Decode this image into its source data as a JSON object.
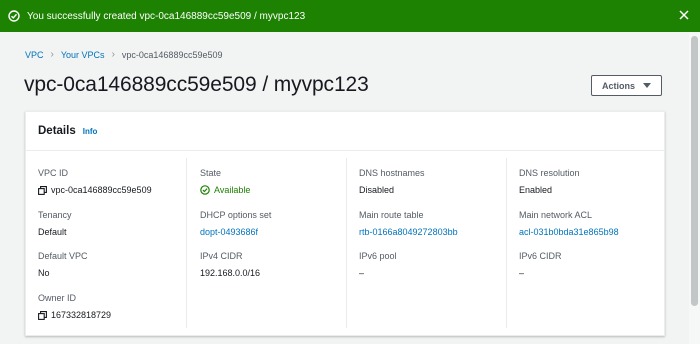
{
  "flash": {
    "message": "You successfully created vpc-0ca146889cc59e509 / myvpc123"
  },
  "breadcrumbs": [
    "VPC",
    "Your VPCs",
    "vpc-0ca146889cc59e509"
  ],
  "title": "vpc-0ca146889cc59e509 / myvpc123",
  "actions_label": "Actions",
  "details": {
    "heading": "Details",
    "info": "Info",
    "fields": {
      "vpc_id": {
        "label": "VPC ID",
        "value": "vpc-0ca146889cc59e509"
      },
      "tenancy": {
        "label": "Tenancy",
        "value": "Default"
      },
      "default_vpc": {
        "label": "Default VPC",
        "value": "No"
      },
      "owner_id": {
        "label": "Owner ID",
        "value": "167332818729"
      },
      "state": {
        "label": "State",
        "value": "Available"
      },
      "dhcp": {
        "label": "DHCP options set",
        "value": "dopt-0493686f"
      },
      "ipv4": {
        "label": "IPv4 CIDR",
        "value": "192.168.0.0/16"
      },
      "dns_hostnames": {
        "label": "DNS hostnames",
        "value": "Disabled"
      },
      "main_route_table": {
        "label": "Main route table",
        "value": "rtb-0166a8049272803bb"
      },
      "ipv6_pool": {
        "label": "IPv6 pool",
        "value": "–"
      },
      "dns_resolution": {
        "label": "DNS resolution",
        "value": "Enabled"
      },
      "main_acl": {
        "label": "Main network ACL",
        "value": "acl-031b0bda31e865b98"
      },
      "ipv6_cidr": {
        "label": "IPv6 CIDR",
        "value": "–"
      }
    }
  },
  "colors": {
    "success": "#1d8102",
    "link": "#0073bb",
    "text": "#16191f",
    "muted": "#545b64"
  },
  "icons": [
    "success-check-icon",
    "close-icon",
    "chevron-right-icon",
    "caret-down-icon",
    "copy-icon",
    "status-available-icon"
  ]
}
